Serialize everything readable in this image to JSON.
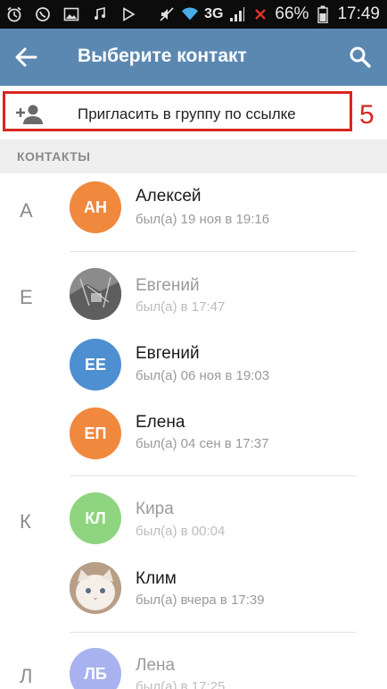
{
  "status_bar": {
    "network": "3G",
    "battery": "66%",
    "time": "17:49",
    "icons": [
      "alarm-icon",
      "viber-icon",
      "gallery-icon",
      "music-icon",
      "play-store-icon",
      "mute-icon",
      "wifi-icon",
      "signal-icon",
      "no-sim-icon",
      "battery-icon"
    ]
  },
  "app_bar": {
    "title": "Выберите контакт",
    "back_icon": "arrow-back-icon",
    "search_icon": "search-icon",
    "color": "#5b88b1"
  },
  "invite": {
    "label": "Пригласить в группу по ссылке",
    "icon": "add-person-icon",
    "step_number": "5",
    "highlight_color": "#d8261f"
  },
  "section_header": "КОНТАКТЫ",
  "groups": [
    {
      "letter": "А",
      "contacts": [
        {
          "initials": "АН",
          "name": "Алексей",
          "status": "был(а) 19 ноя в 19:16",
          "color": "#f0883e"
        }
      ]
    },
    {
      "letter": "Е",
      "contacts": [
        {
          "initials": "",
          "name": "Евгений",
          "status": "был(а) в 17:47",
          "color": "#7d7d7d",
          "photo": true
        },
        {
          "initials": "ЕЕ",
          "name": "Евгений",
          "status": "был(а) 06 ноя в 19:03",
          "color": "#4d8fd0"
        },
        {
          "initials": "ЕП",
          "name": "Елена",
          "status": "был(а) 04 сен в 17:37",
          "color": "#f0883e"
        }
      ]
    },
    {
      "letter": "К",
      "contacts": [
        {
          "initials": "КЛ",
          "name": "Кира",
          "status": "был(а) в 00:04",
          "color": "#8fd47f"
        },
        {
          "initials": "",
          "name": "Клим",
          "status": "был(а) вчера в 17:39",
          "color": "#c9b9a8",
          "photo": true
        }
      ]
    },
    {
      "letter": "Л",
      "contacts": [
        {
          "initials": "ЛБ",
          "name": "Лена",
          "status": "был(а) в 17:25",
          "color": "#a7b2ee"
        }
      ]
    }
  ]
}
